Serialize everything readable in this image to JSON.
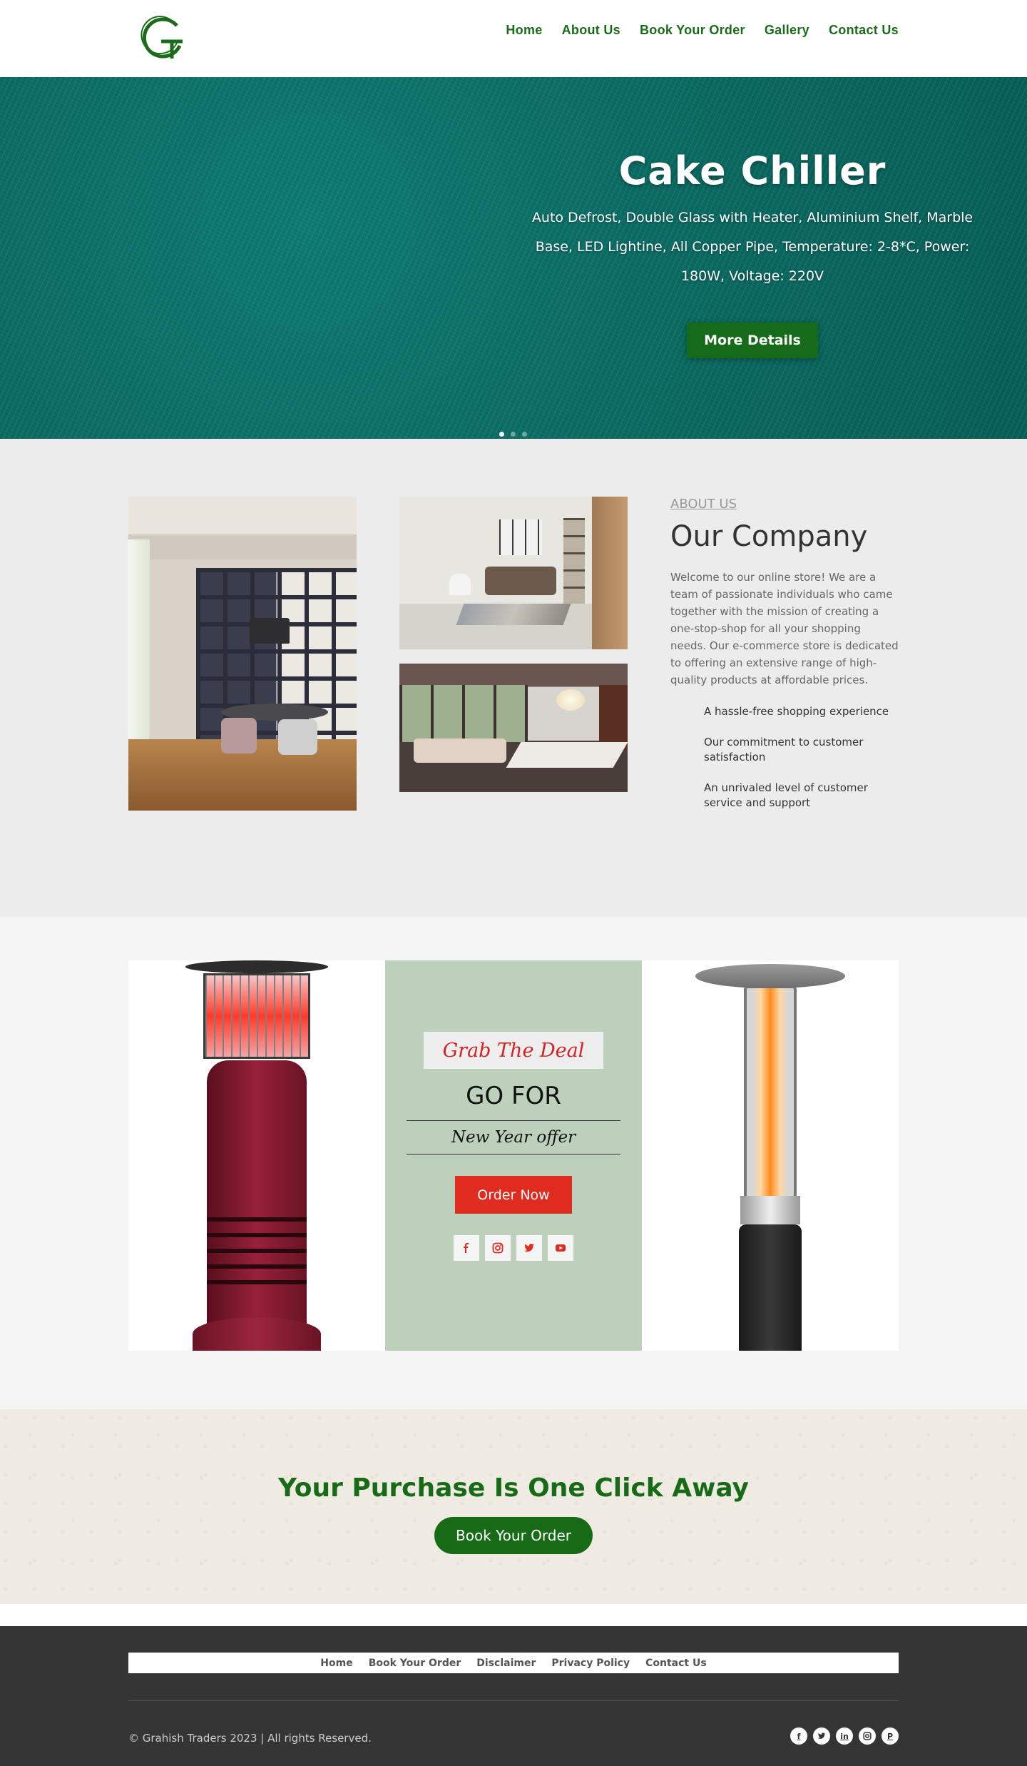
{
  "header": {
    "logo_text": "G",
    "nav": [
      {
        "label": "Home"
      },
      {
        "label": "About Us"
      },
      {
        "label": "Book Your Order"
      },
      {
        "label": "Gallery"
      },
      {
        "label": "Contact Us"
      }
    ]
  },
  "hero": {
    "title": "Cake Chiller",
    "description": "Auto Defrost, Double Glass with Heater, Aluminium Shelf, Marble Base, LED Lightine, All Copper Pipe, Temperature: 2-8*C, Power: 180W, Voltage: 220V",
    "button": "More Details",
    "slides": 3,
    "active_slide": 1
  },
  "about": {
    "label": "ABOUT US",
    "title": "Our Company",
    "body": "Welcome to our online store! We are a team of passionate individuals who came together with the mission of creating a one-stop-shop for all your shopping needs. Our e-commerce store is dedicated to offering an extensive range of high-quality products at affordable prices.",
    "features": [
      "A hassle-free shopping experience",
      "Our commitment to customer satisfaction",
      "An unrivaled level of customer service and support"
    ]
  },
  "deal": {
    "grab": "Grab The Deal",
    "go_for": "GO FOR",
    "offer": "New Year offer",
    "button": "Order Now",
    "social": [
      "facebook-icon",
      "instagram-icon",
      "twitter-icon",
      "youtube-icon"
    ]
  },
  "cta": {
    "title": "Your Purchase Is One Click Away",
    "button": "Book Your Order"
  },
  "footer": {
    "nav": [
      {
        "label": "Home"
      },
      {
        "label": "Book Your Order"
      },
      {
        "label": "Disclaimer"
      },
      {
        "label": "Privacy Policy"
      },
      {
        "label": "Contact Us"
      }
    ],
    "copyright": "© Grahish Traders 2023 | All rights Reserved.",
    "social": [
      "facebook-icon",
      "twitter-icon",
      "linkedin-icon",
      "instagram-icon",
      "pinterest-icon"
    ]
  },
  "colors": {
    "brand_green": "#176b17",
    "accent_red": "#e02b20",
    "hero_teal": "#0a6a62",
    "deal_green": "#bdd0bb",
    "footer_dark": "#353535"
  }
}
